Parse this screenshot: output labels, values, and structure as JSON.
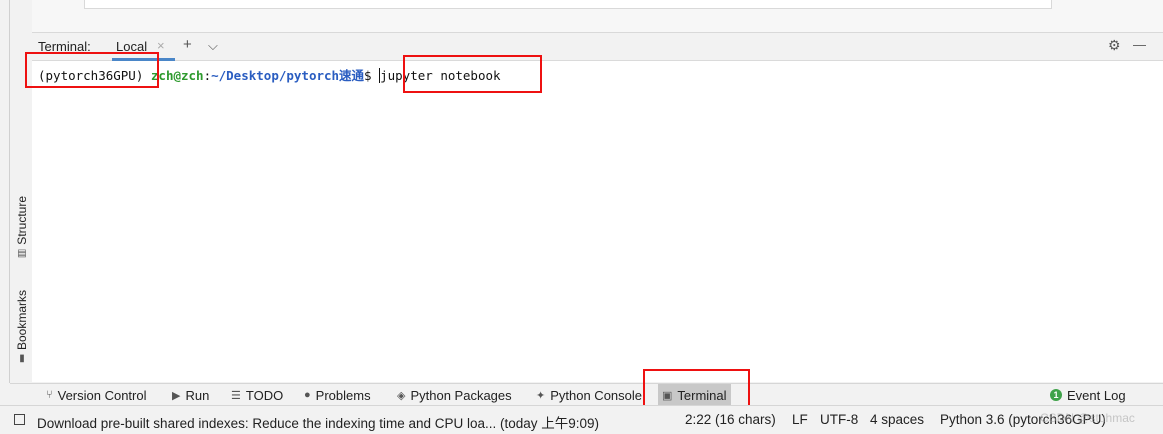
{
  "side_tabs": {
    "structure": "Structure",
    "bookmarks": "Bookmarks"
  },
  "terminal": {
    "title": "Terminal:",
    "tab_label": "Local",
    "tab_close": "×",
    "add_btn": "+",
    "dropdown_btn": "⌵",
    "settings_btn": "⚙",
    "minimize_btn": "—",
    "env": "(pytorch36GPU)",
    "user_host": "zch@zch",
    "colon": ":",
    "path": "~/Desktop/pytorch速通",
    "dollar": "$",
    "command": "jupyter notebook"
  },
  "tool_windows": [
    {
      "label": "Version Control",
      "icon": "branch-icon"
    },
    {
      "label": "Run",
      "icon": "play-icon"
    },
    {
      "label": "TODO",
      "icon": "list-icon"
    },
    {
      "label": "Problems",
      "icon": "info-circle-icon"
    },
    {
      "label": "Python Packages",
      "icon": "layers-icon"
    },
    {
      "label": "Python Console",
      "icon": "python-icon"
    },
    {
      "label": "Terminal",
      "icon": "terminal-icon",
      "active": true
    }
  ],
  "event_log": {
    "label": "Event Log",
    "count": "1"
  },
  "status": {
    "message": "Download pre-built shared indexes: Reduce the indexing time and CPU loa... (today 上午9:09)",
    "position": "2:22 (16 chars)",
    "line_sep": "LF",
    "encoding": "UTF-8",
    "indent": "4 spaces",
    "interpreter": "Python 3.6 (pytorch36GPU)"
  },
  "watermark": "CSDN @stuhmac",
  "colors": {
    "highlight": "#e11",
    "path": "#2a5dc1",
    "user": "#2d9a2d",
    "tab_underline": "#4a86c8"
  }
}
